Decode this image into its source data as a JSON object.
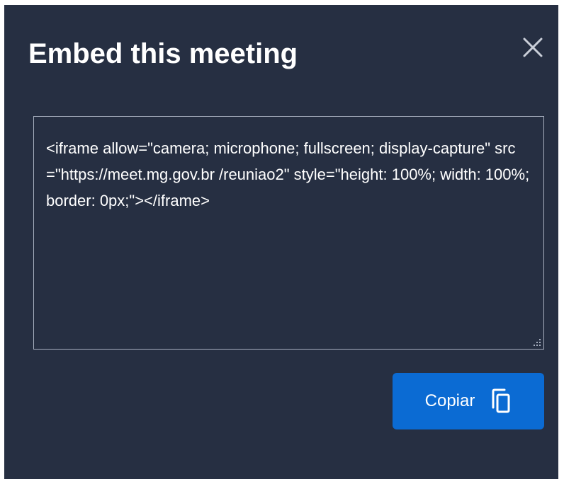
{
  "dialog": {
    "title": "Embed this meeting",
    "close_icon": "close-icon",
    "embed_code": "<iframe allow=\"camera; microphone; fullscreen; display-capture\" src=\"https://meet.mg.gov.br /reuniao2\" style=\"height: 100%; width: 100%; border: 0px;\"></iframe>",
    "copy_button": {
      "label": "Copiar",
      "icon": "copy-icon"
    }
  },
  "colors": {
    "background": "#262f42",
    "accent": "#0b6bd3",
    "text": "#ffffff",
    "border": "#a8b0c0"
  }
}
